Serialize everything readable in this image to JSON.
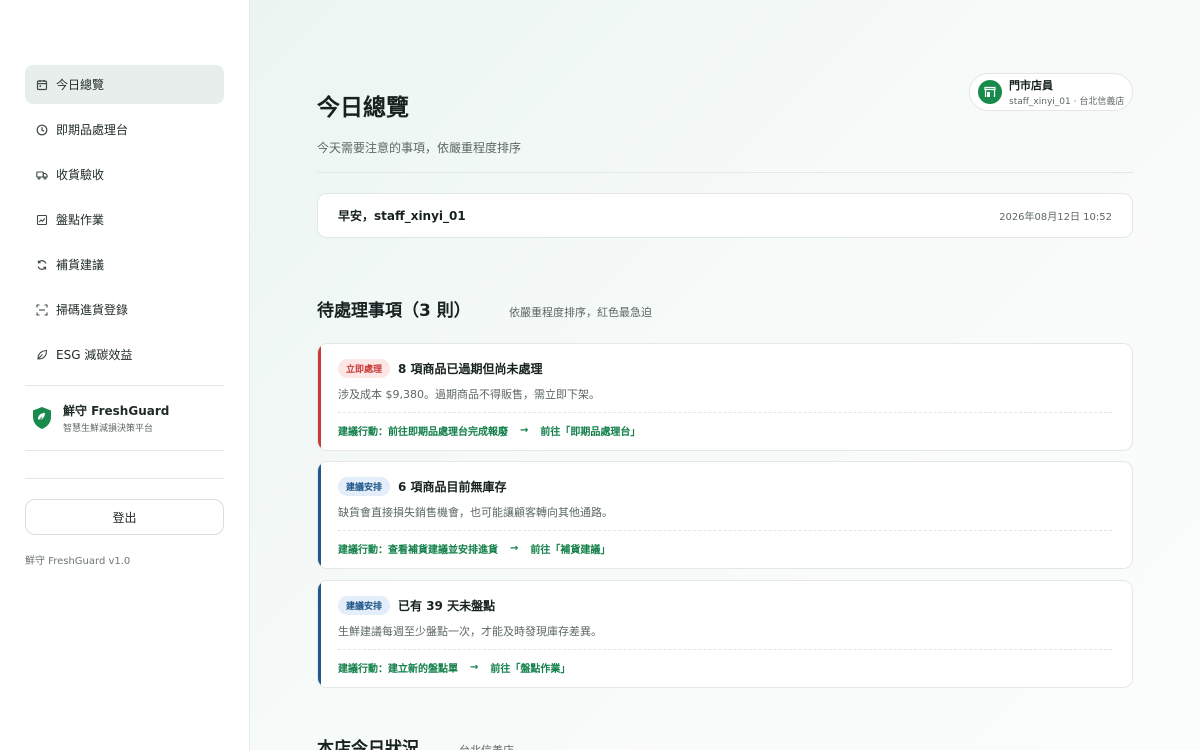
{
  "sidebar": {
    "items": [
      {
        "label": "今日總覽",
        "icon": "calendar-icon"
      },
      {
        "label": "即期品處理台",
        "icon": "clock-icon"
      },
      {
        "label": "收貨驗收",
        "icon": "truck-icon"
      },
      {
        "label": "盤點作業",
        "icon": "clipboard-icon"
      },
      {
        "label": "補貨建議",
        "icon": "refresh-icon"
      },
      {
        "label": "掃碼進貨登錄",
        "icon": "scan-icon"
      },
      {
        "label": "ESG 減碳效益",
        "icon": "leaf-icon"
      }
    ],
    "brand": {
      "name": "鮮守 FreshGuard",
      "subtitle": "智慧生鮮減損決策平台"
    },
    "logout_label": "登出",
    "version": "鮮守 FreshGuard v1.0"
  },
  "header": {
    "title": "今日總覽",
    "subtitle": "今天需要注意的事項，依嚴重程度排序",
    "user": {
      "role": "門市店員",
      "store": "staff_xinyi_01 · 台北信義店"
    }
  },
  "greeting": {
    "text": "早安，staff_xinyi_01",
    "datetime": "2026年08月12日 10:52"
  },
  "tasks_section": {
    "title": "待處理事項（3 則）",
    "hint": "依嚴重程度排序，紅色最急迫"
  },
  "tasks": [
    {
      "badge": "立即處理",
      "title": "8 項商品已過期但尚未處理",
      "desc": "涉及成本 $9,380。過期商品不得販售，需立即下架。",
      "action": "建議行動：前往即期品處理台完成報廢",
      "link": "前往「即期品處理台」"
    },
    {
      "badge": "建議安排",
      "title": "6 項商品目前無庫存",
      "desc": "缺貨會直接損失銷售機會，也可能讓顧客轉向其他通路。",
      "action": "建議行動：查看補貨建議並安排進貨",
      "link": "前往「補貨建議」"
    },
    {
      "badge": "建議安排",
      "title": "已有 39 天未盤點",
      "desc": "生鮮建議每週至少盤點一次，才能及時發現庫存差異。",
      "action": "建議行動：建立新的盤點單",
      "link": "前往「盤點作業」"
    }
  ],
  "status_section": {
    "title": "本店今日狀況",
    "hint": "台北信義店"
  },
  "colors": {
    "accent": "#13804a",
    "urgent": "#c93a3a",
    "suggest": "#21578a"
  }
}
